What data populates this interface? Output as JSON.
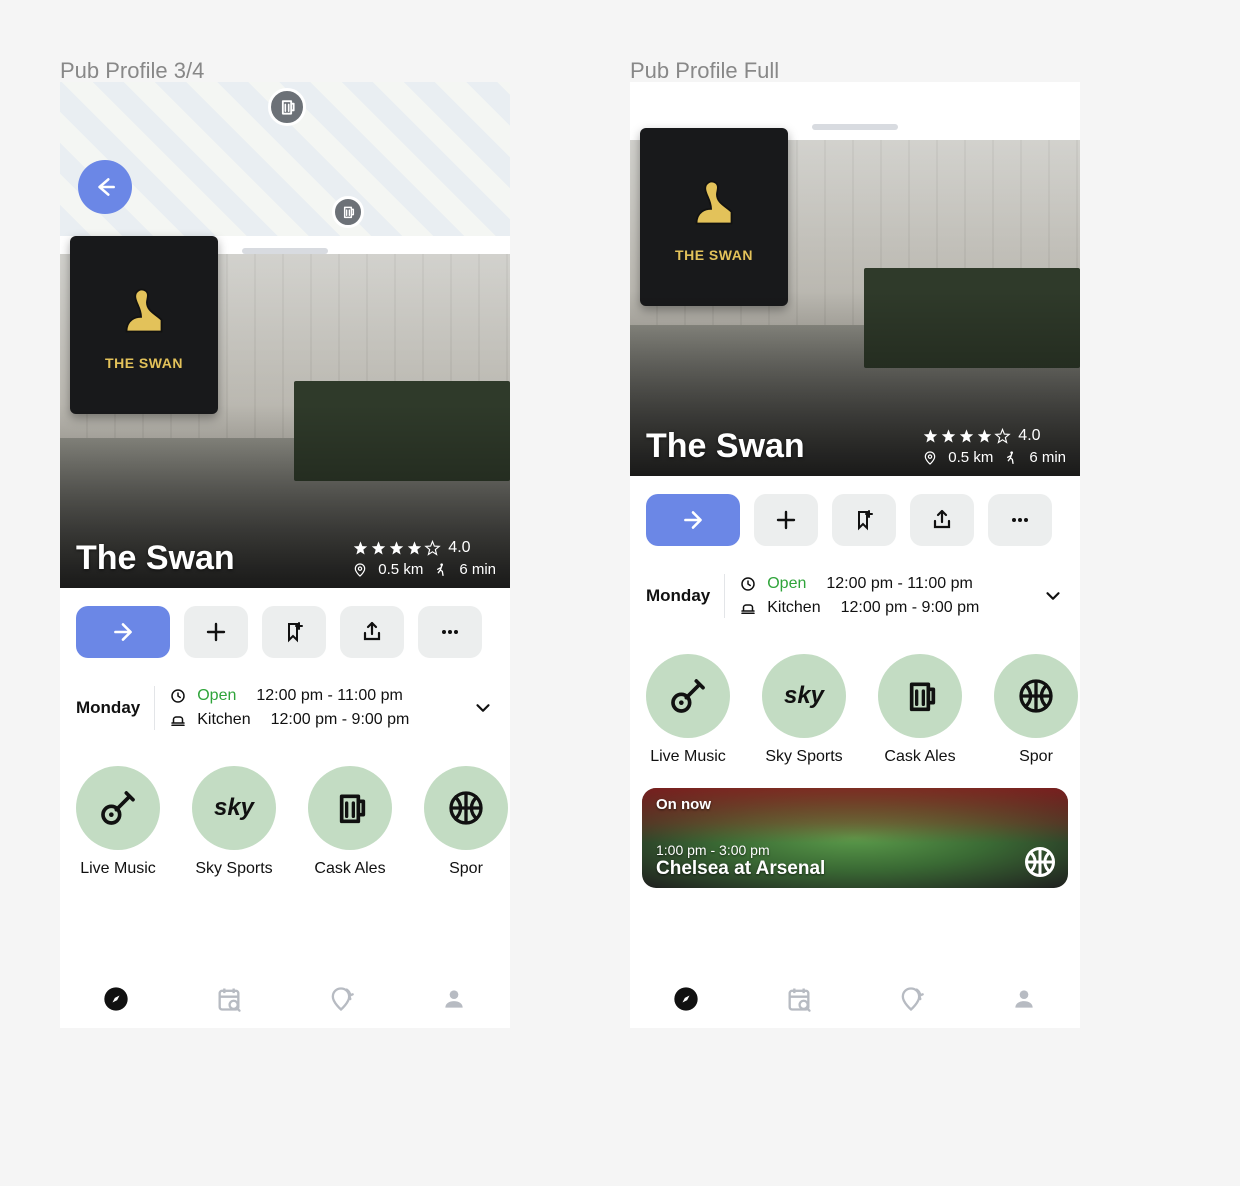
{
  "screens": {
    "left_label": "Pub Profile 3/4",
    "right_label": "Pub Profile Full"
  },
  "pub": {
    "name": "The Swan",
    "sign_text": "THE SWAN",
    "rating": "4.0",
    "distance": "0.5 km",
    "walk_time": "6 min"
  },
  "hours": {
    "day": "Monday",
    "status": "Open",
    "open_hours": "12:00 pm - 11:00 pm",
    "kitchen_label": "Kitchen",
    "kitchen_hours": "12:00 pm - 9:00 pm"
  },
  "features": [
    {
      "id": "live-music",
      "label": "Live Music"
    },
    {
      "id": "sky-sports",
      "label": "Sky Sports"
    },
    {
      "id": "cask-ales",
      "label": "Cask Ales"
    },
    {
      "id": "sports",
      "label": "Spor"
    }
  ],
  "event": {
    "badge": "On now",
    "time": "1:00 pm - 3:00 pm",
    "title": "Chelsea at Arsenal"
  },
  "actions": {
    "directions": "Directions",
    "add": "Add",
    "save": "Save",
    "share": "Share",
    "more": "More"
  },
  "tabs": [
    {
      "id": "explore",
      "active": true
    },
    {
      "id": "calendar",
      "active": false
    },
    {
      "id": "checkin",
      "active": false
    },
    {
      "id": "profile",
      "active": false
    }
  ],
  "icons": {
    "sky_text": "sky"
  }
}
